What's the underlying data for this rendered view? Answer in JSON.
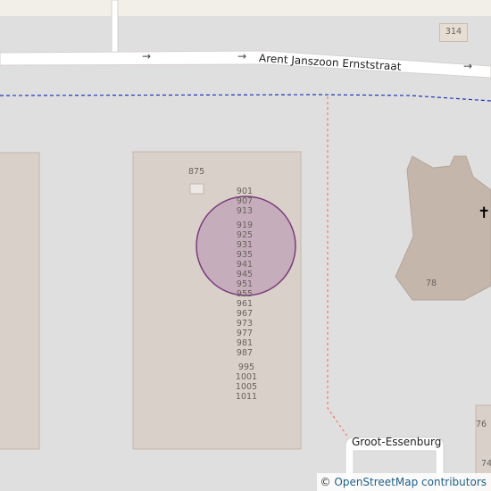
{
  "map": {
    "street_main": "Arent Janszoon Ernststraat",
    "street_side": "Groot-Essenburg",
    "shield_314": "314",
    "house_875": "875",
    "house_78": "78",
    "house_76": "76",
    "house_74": "74",
    "church_symbol": "✝",
    "numbers_group1": [
      "901",
      "907",
      "913"
    ],
    "numbers_group2": [
      "919",
      "925",
      "931",
      "935",
      "941",
      "945",
      "951",
      "955",
      "961",
      "967",
      "973",
      "977",
      "981",
      "987"
    ],
    "numbers_group3": [
      "995",
      "1001",
      "1005",
      "1011"
    ],
    "one_way_arrow": "→"
  },
  "attribution": {
    "copyright": "©",
    "text": "OpenStreetMap contributors"
  },
  "colors": {
    "background": "#e0dfdf",
    "building": "#d9d0c9",
    "building_stroke": "#c4b6ab",
    "place_of_worship": "#c4b6ab",
    "road": "#ffffff",
    "boundary": "#1f34b8",
    "footpath": "#f07d6b",
    "marker_fill": "#a777a7",
    "marker_stroke": "#7a3d7a"
  }
}
